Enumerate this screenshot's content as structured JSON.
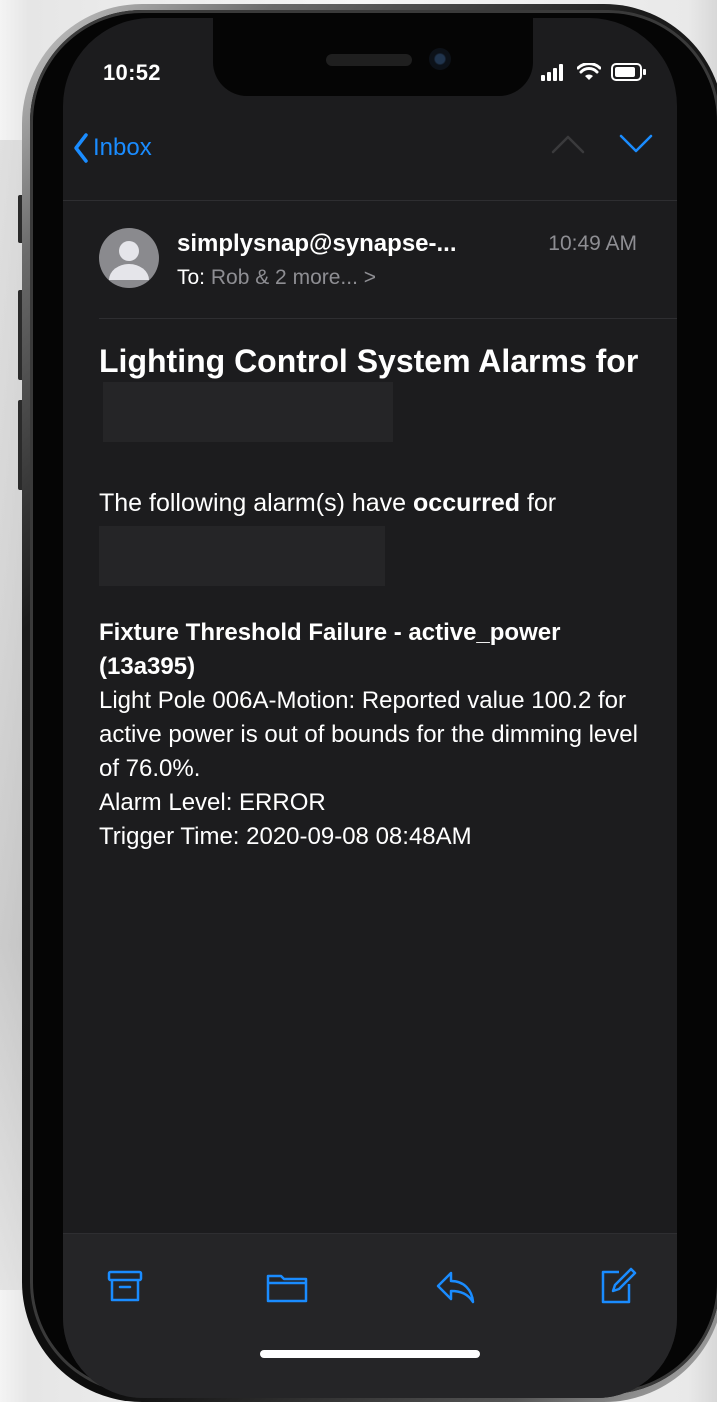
{
  "status_bar": {
    "time": "10:52"
  },
  "nav": {
    "back_label": "Inbox"
  },
  "message": {
    "sender": "simplysnap@synapse-...",
    "received_time": "10:49 AM",
    "to_label": "To:",
    "recipients": "Rob & 2 more... >",
    "subject": "Lighting Control System Alarms for",
    "intro_prefix": "The following alarm(s) have ",
    "intro_bold": "occurred",
    "intro_suffix": " for",
    "alarm": {
      "title": "Fixture Threshold Failure - active_power (13a395)",
      "description": "Light Pole 006A-Motion: Reported value 100.2 for active power is out of bounds for the dimming level of 76.0%.",
      "level": "Alarm Level: ERROR",
      "trigger": "Trigger Time: 2020-09-08 08:48AM"
    }
  },
  "icons": {
    "toolbar": [
      "archive-icon",
      "folder-icon",
      "reply-icon",
      "compose-icon"
    ],
    "nav": [
      "chevron-left-icon",
      "chevron-up-icon",
      "chevron-down-icon"
    ]
  },
  "colors": {
    "accent": "#1a8cff",
    "background": "#1c1c1e",
    "secondary_text": "#8e8e93"
  }
}
